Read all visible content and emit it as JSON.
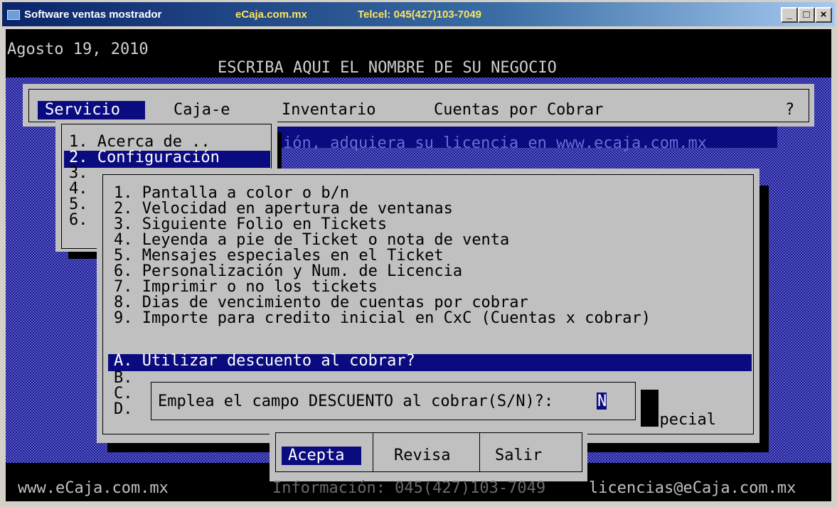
{
  "titlebar": {
    "app": "Software ventas mostrador",
    "site": "eCaja.com.mx",
    "phone": "Telcel: 045(427)103-7049",
    "buttons": [
      "_",
      "□",
      "×"
    ]
  },
  "header": {
    "date": "Agosto 19, 2010",
    "business_name": "ESCRIBA AQUI EL NOMBRE DE SU NEGOCIO"
  },
  "menubar": {
    "items": [
      "Servicio",
      "Caja-e",
      "Inventario",
      "Cuentas por Cobrar",
      "?"
    ],
    "active": "Servicio"
  },
  "marquee": "ión, adquiera su licencia en www.ecaja.com.mx",
  "servicio_menu": {
    "items": [
      "1. Acerca de ..",
      "2. Configuración",
      "3.",
      "4.",
      "5.",
      "6."
    ],
    "selected": "2. Configuración"
  },
  "config_menu": {
    "items": [
      "1. Pantalla a color o b/n",
      "2. Velocidad en apertura de ventanas",
      "3. Siguiente Folio en Tickets",
      "4. Leyenda a pie de Ticket o nota de venta",
      "5. Mensajes especiales en el Ticket",
      "6. Personalización y Num. de Licencia",
      "7. Imprimir o no los tickets",
      "8. Dias de vencimiento de cuentas por cobrar",
      "9. Importe para credito inicial en CxC (Cuentas x cobrar)",
      "A. Utilizar descuento al cobrar?",
      "B.",
      "C.",
      "D."
    ],
    "selected": "A. Utilizar descuento al cobrar?",
    "trailing_text": "especial"
  },
  "prompt": {
    "label": "Emplea el campo DESCUENTO al cobrar(S/N)?:",
    "value": "N"
  },
  "buttons": {
    "accept": "Acepta",
    "review": "Revisa",
    "exit": "Salir"
  },
  "statusbar": {
    "site": "www.eCaja.com.mx",
    "info": "Información: 045(427)103-7049",
    "email": "licencias@eCaja.com.mx"
  },
  "colors": {
    "title_gradient_start": "#0a246a",
    "highlight": "#0b0b80",
    "panel": "#c0c0c0",
    "pattern": "#2b2b9c"
  }
}
